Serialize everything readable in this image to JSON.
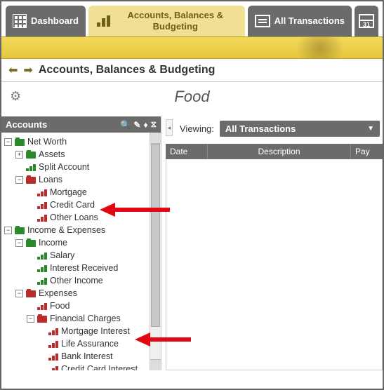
{
  "tabs": {
    "dashboard": "Dashboard",
    "accounts": "Accounts, Balances & Budgeting",
    "transactions": "All Transactions",
    "calendar_day": "31"
  },
  "breadcrumb": "Accounts, Balances & Budgeting",
  "page_title": "Food",
  "sidebar": {
    "title": "Accounts",
    "tree": {
      "net_worth": "Net Worth",
      "assets": "Assets",
      "split_account": "Split Account",
      "loans": "Loans",
      "mortgage": "Mortgage",
      "credit_card": "Credit Card",
      "other_loans": "Other Loans",
      "income_expenses": "Income & Expenses",
      "income": "Income",
      "salary": "Salary",
      "interest_received": "Interest Received",
      "other_income": "Other Income",
      "expenses": "Expenses",
      "food": "Food",
      "financial_charges": "Financial Charges",
      "mortgage_interest": "Mortgage Interest",
      "life_assurance": "Life Assurance",
      "bank_interest": "Bank Interest",
      "credit_card_interest": "Credit Card Interest"
    }
  },
  "viewing": {
    "label": "Viewing:",
    "value": "All Transactions"
  },
  "grid": {
    "date": "Date",
    "description": "Description",
    "pay": "Pay"
  }
}
